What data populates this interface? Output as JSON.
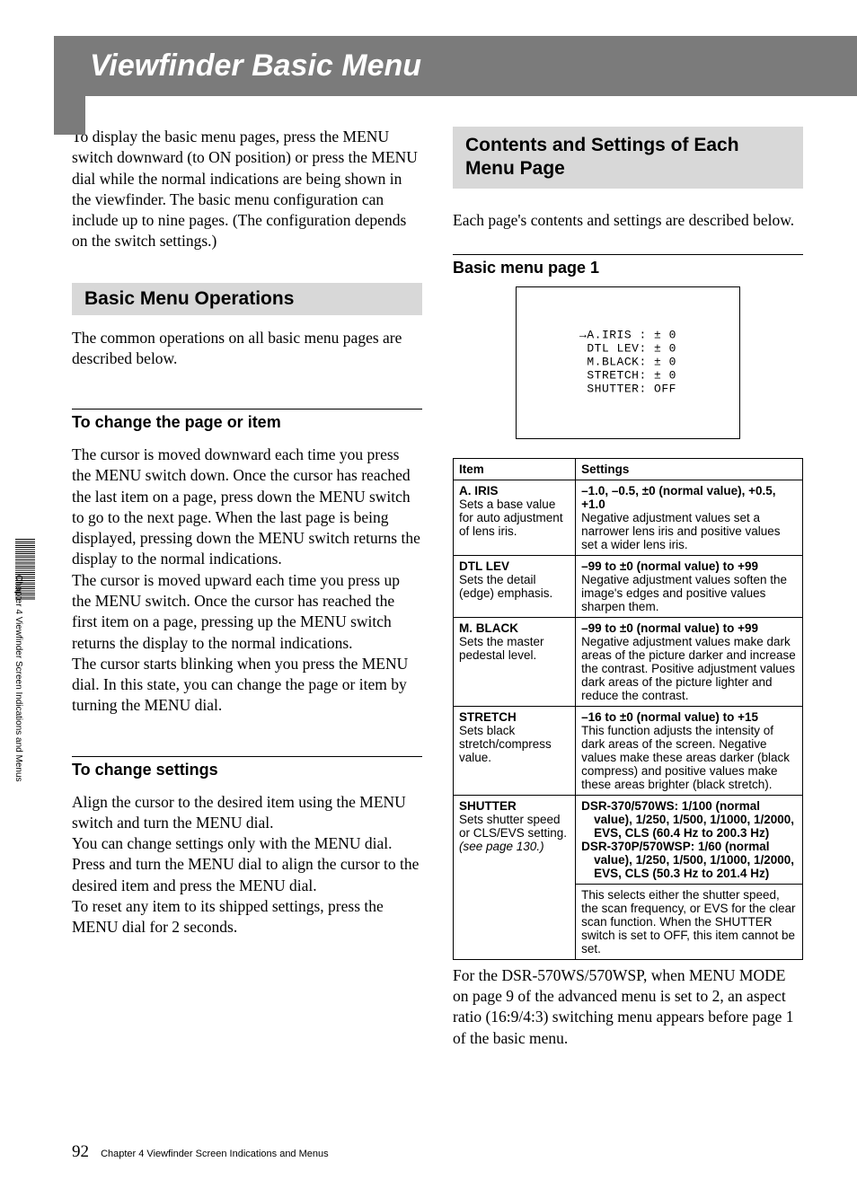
{
  "title": "Viewfinder Basic Menu",
  "sidebar_text": "Chapter 4 Viewfinder Screen Indications and Menus",
  "intro": "To display the basic menu pages, press the MENU switch downward (to ON position) or press the MENU dial while the normal indications are being shown in the viewfinder.  The basic menu configuration can include up to nine pages. (The configuration depends on the switch settings.)",
  "left": {
    "sec1_title": "Basic Menu Operations",
    "sec1_intro": "The common operations on all basic menu pages are described below.",
    "sub1_title": "To change the page or item",
    "sub1_p1": "The cursor is moved downward each time you press the MENU switch down.  Once the cursor has reached the last item on a page, press down the MENU switch to go to the next page.  When the last page is being displayed, pressing down the MENU switch returns the display to the normal indications.",
    "sub1_p2": "The cursor is moved upward each time you press up the MENU switch.  Once the cursor has reached the first item on a page, pressing up the MENU switch returns the display to the normal indications.",
    "sub1_p3": "The cursor starts blinking when you press the MENU dial.  In this state, you can change the page or item by turning the MENU dial.",
    "sub2_title": "To change settings",
    "sub2_p1": "Align the cursor to the desired item using the MENU switch and turn the MENU dial.",
    "sub2_p2": "You can change settings only with the MENU dial.",
    "sub2_p3": "Press and turn the MENU dial to align the cursor to the desired item and press the MENU dial.",
    "sub2_p4": "To reset any item to its shipped settings, press the MENU dial for 2 seconds."
  },
  "right": {
    "sec_title": "Contents and Settings of Each Menu Page",
    "intro": "Each page's contents and settings are described below.",
    "basic1_title": "Basic menu page 1",
    "screen_text": "→A.IRIS : ± 0\n DTL LEV: ± 0\n M.BLACK: ± 0\n STRETCH: ± 0\n SHUTTER: OFF",
    "table": {
      "h_item": "Item",
      "h_settings": "Settings",
      "rows": [
        {
          "name": "A. IRIS",
          "desc": "Sets a base value for auto adjustment of lens iris.",
          "lead": "–1.0, –0.5, ±0 (normal value), +0.5, +1.0",
          "body": "Negative adjustment values set a narrower lens iris and positive values set a wider lens iris."
        },
        {
          "name": "DTL LEV",
          "desc": "Sets the detail (edge) emphasis.",
          "lead": "–99 to ±0 (normal value) to +99",
          "body": "Negative adjustment values soften the image's edges and positive values sharpen them."
        },
        {
          "name": "M. BLACK",
          "desc": "Sets the master pedestal level.",
          "lead": "–99 to ±0 (normal value) to +99",
          "body": "Negative adjustment values make dark areas of the picture darker and increase the contrast.  Positive adjustment values dark areas of the picture lighter and reduce the contrast."
        },
        {
          "name": "STRETCH",
          "desc": "Sets black stretch/compress value.",
          "lead": "–16 to ±0 (normal value) to +15",
          "body": "This function adjusts the intensity of dark areas of the screen.  Negative values make these areas darker (black compress) and positive values make these areas brighter (black stretch)."
        },
        {
          "name": "SHUTTER",
          "desc_plain": "Sets shutter speed or CLS/EVS setting. ",
          "desc_ital": "(see page 130.)",
          "shutter_a": "DSR-370/570WS:  1/100 (normal value), 1/250, 1/500, 1/1000, 1/2000, EVS, CLS (60.4 Hz to 200.3 Hz)",
          "shutter_b": "DSR-370P/570WSP:  1/60 (normal value), 1/250, 1/500, 1/1000, 1/2000, EVS, CLS (50.3 Hz to 201.4 Hz)",
          "extra": "This selects either the shutter speed, the scan frequency, or EVS for the clear scan function. When the SHUTTER switch is set to OFF, this item cannot be set."
        }
      ]
    },
    "footnote": "For the DSR-570WS/570WSP, when MENU MODE on page 9 of the advanced menu is set to 2, an aspect ratio (16:9/4:3) switching menu appears before page 1 of the basic menu."
  },
  "footer": {
    "page": "92",
    "chapter": "Chapter 4   Viewfinder Screen Indications and Menus"
  }
}
